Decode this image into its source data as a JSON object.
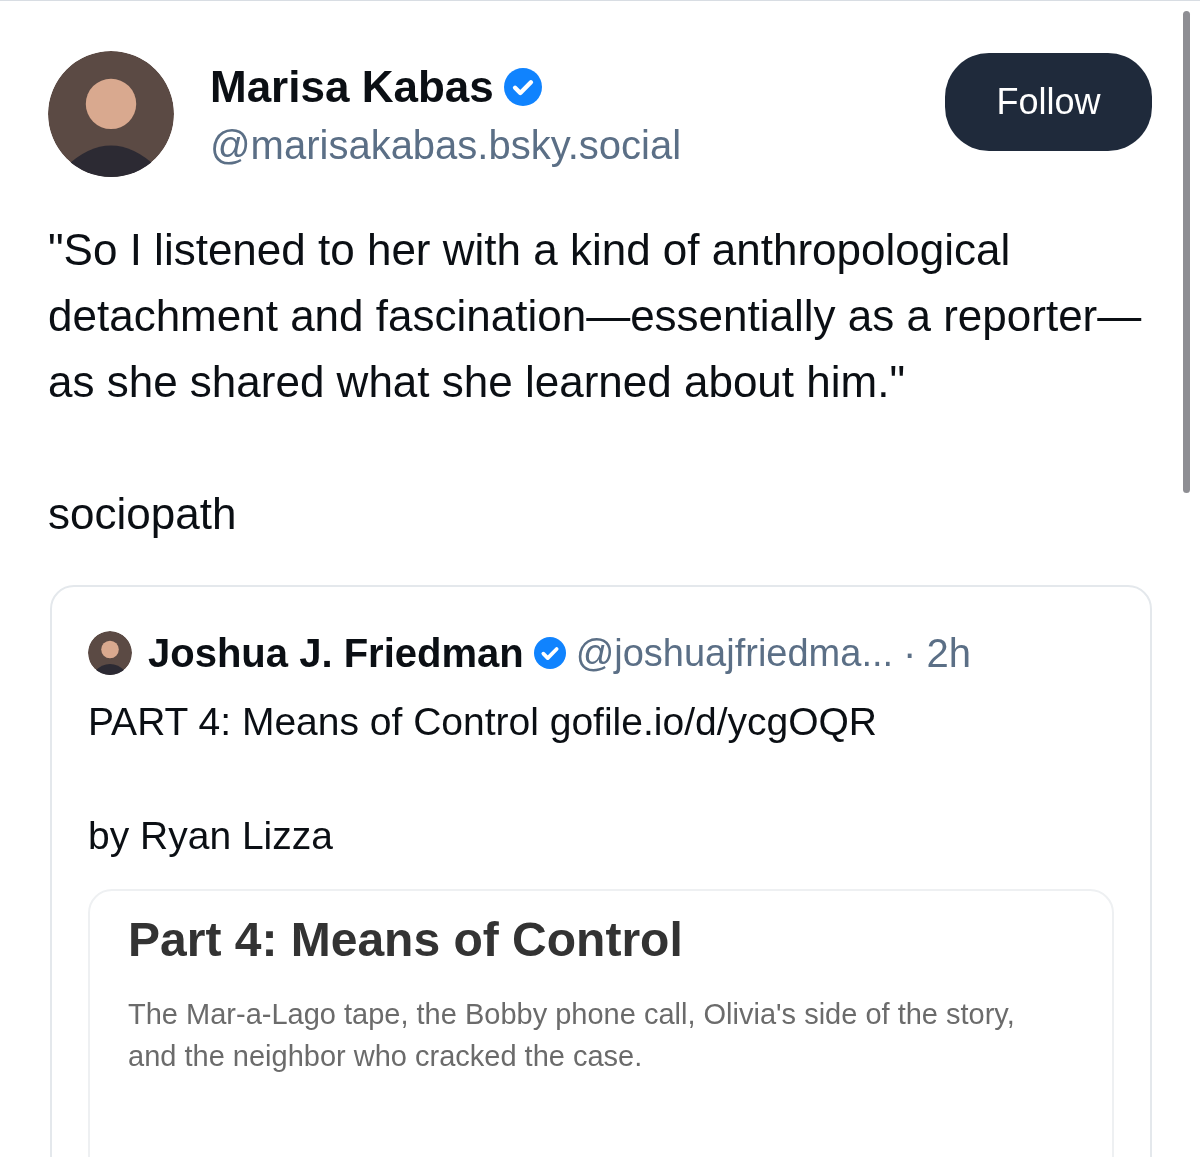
{
  "author": {
    "name": "Marisa Kabas",
    "verified": true,
    "handle": "@marisakabas.bsky.social"
  },
  "follow_button": "Follow",
  "post": {
    "paragraphs": [
      "\"So I listened to her with a kind of anthropological detachment and fascination—essentially as a reporter—as she shared what she learned about him.\"",
      "sociopath"
    ]
  },
  "quote": {
    "author": {
      "name": "Joshua J. Friedman",
      "verified": true,
      "handle": "@joshuajfriedma...",
      "separator": "·",
      "time": "2h"
    },
    "paragraphs": [
      "PART 4: Means of Control gofile.io/d/ycgOQR",
      "by Ryan Lizza"
    ],
    "embed": {
      "title": "Part 4: Means of Control",
      "description": "The Mar-a-Lago tape, the Bobby phone call, Olivia's side of the story, and the neighbor who cracked the case."
    }
  }
}
